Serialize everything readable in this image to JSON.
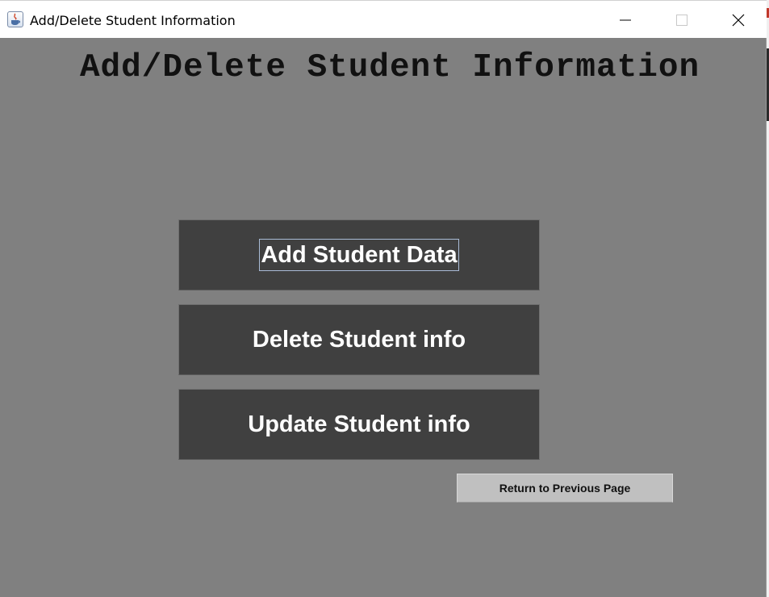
{
  "window": {
    "title": "Add/Delete Student Information",
    "controls": {
      "minimize": "minimize-icon",
      "maximize": "maximize-icon",
      "close": "close-icon"
    }
  },
  "main": {
    "heading": "Add/Delete Student Information",
    "buttons": [
      {
        "label": "Add Student Data"
      },
      {
        "label": "Delete Student info"
      },
      {
        "label": "Update Student info"
      }
    ],
    "return_label": "Return to Previous Page"
  },
  "colors": {
    "background": "#808080",
    "button_dark": "#404040",
    "button_light": "#c0c0c0",
    "focus_outline": "#a9bbd6"
  }
}
